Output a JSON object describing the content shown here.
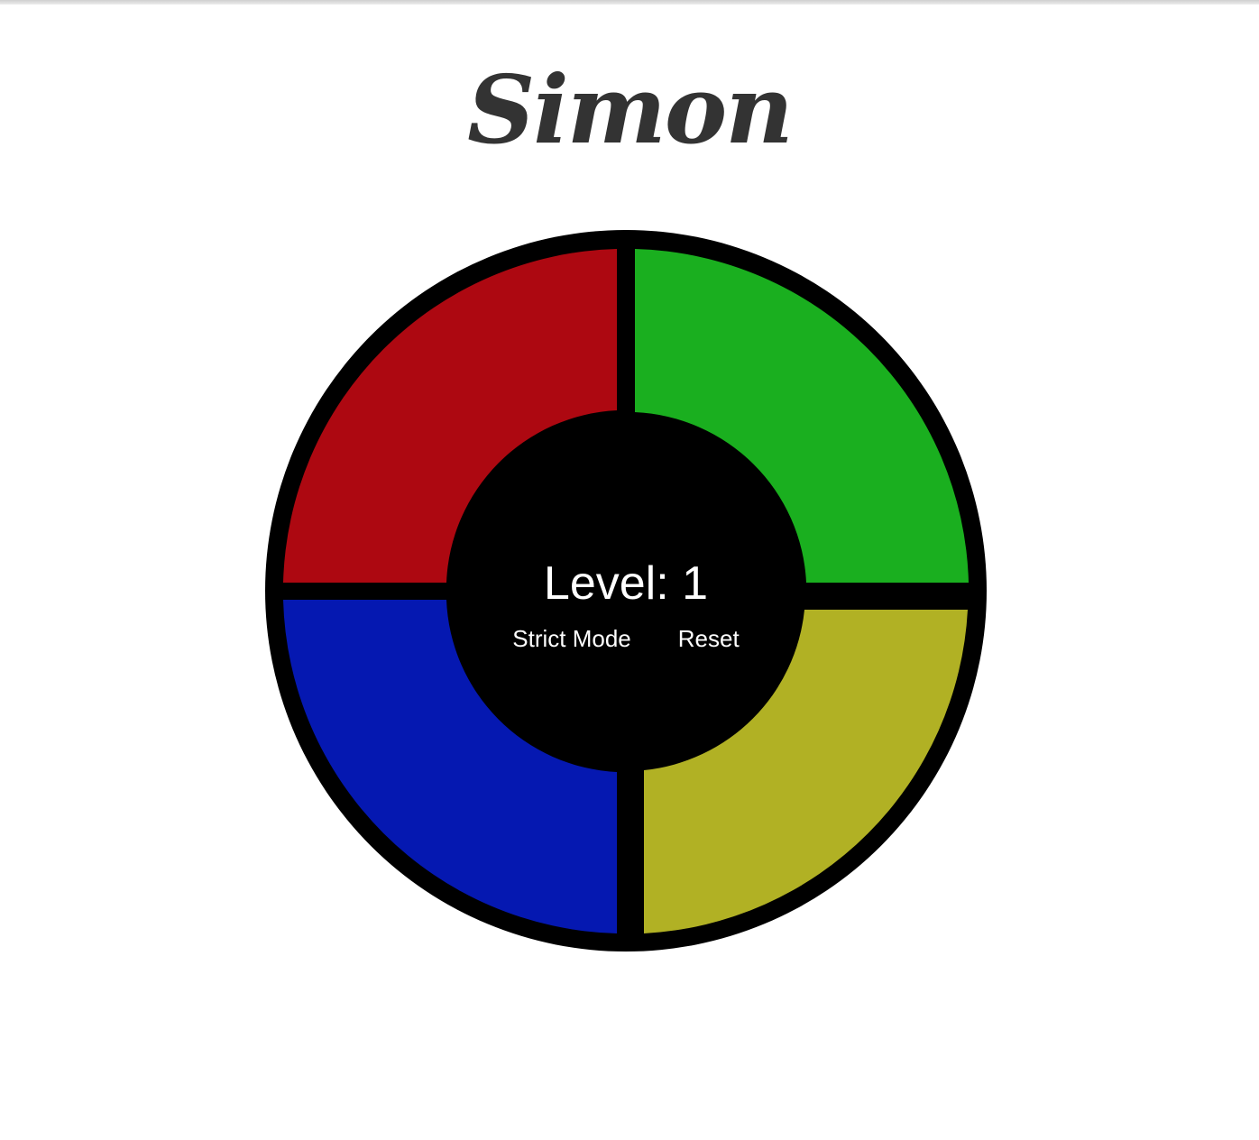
{
  "title": "Simon",
  "status": {
    "level_label": "Level: 1"
  },
  "controls": {
    "strict_label": "Strict Mode",
    "reset_label": "Reset"
  },
  "pads": {
    "red": {
      "color": "#ad0811"
    },
    "green": {
      "color": "#1aaf1f"
    },
    "blue": {
      "color": "#0518b1"
    },
    "yellow": {
      "color": "#b1b124"
    }
  },
  "colors": {
    "board": "#000000",
    "title": "#333333",
    "text": "#ffffff",
    "background": "#ffffff"
  }
}
